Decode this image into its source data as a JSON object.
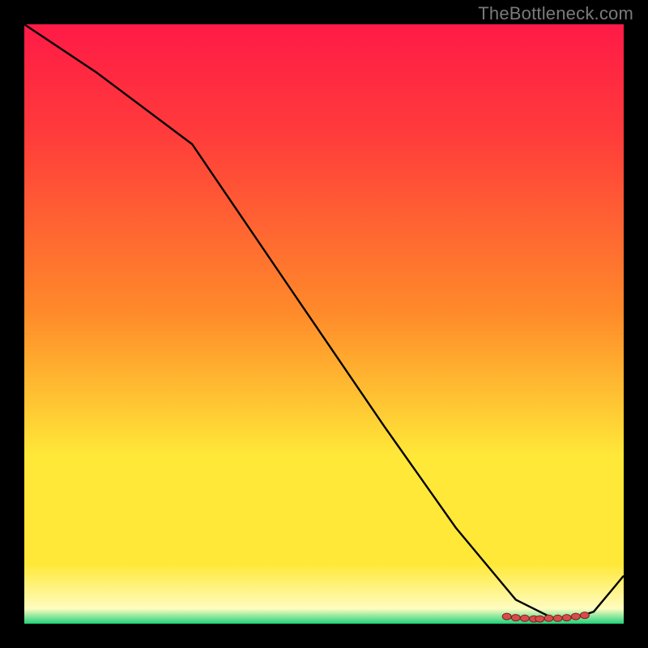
{
  "attribution": "TheBottleneck.com",
  "colors": {
    "background": "#000000",
    "attribution_text": "#7a7a7a",
    "gradient_top": "#ff1a47",
    "gradient_mid_red": "#ff3b3b",
    "gradient_orange": "#ff8a2a",
    "gradient_yellow": "#ffe838",
    "gradient_pale": "#fffcc0",
    "gradient_green": "#21d37b",
    "curve": "#000000",
    "marker_fill": "#d94b4b",
    "marker_stroke": "#7a1f1f"
  },
  "chart_data": {
    "type": "line",
    "title": "",
    "xlabel": "",
    "ylabel": "",
    "xlim": [
      0,
      100
    ],
    "ylim": [
      0,
      100
    ],
    "series": [
      {
        "name": "curve",
        "x": [
          0,
          12,
          28,
          45,
          60,
          72,
          82,
          88,
          92,
          95,
          100
        ],
        "y": [
          100,
          92,
          80,
          55,
          33,
          16,
          4,
          1,
          1,
          2,
          8
        ]
      }
    ],
    "markers": {
      "name": "highlight-cluster",
      "x": [
        80.5,
        82,
        83.5,
        85,
        86,
        87.5,
        89,
        90.5,
        92,
        93.5
      ],
      "y": [
        1.2,
        1.0,
        0.9,
        0.8,
        0.8,
        0.9,
        0.9,
        1.0,
        1.2,
        1.4
      ]
    }
  }
}
